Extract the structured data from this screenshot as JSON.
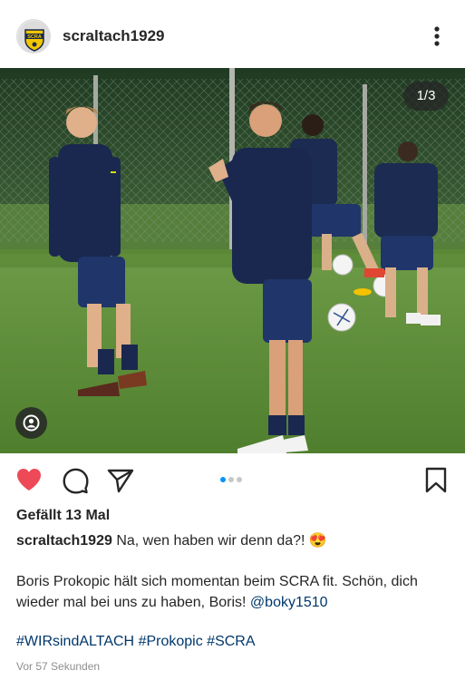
{
  "post": {
    "username": "scraltach1929",
    "avatar_label": "SCRA",
    "image_counter": "1/3",
    "likes": "Gefällt 13 Mal",
    "caption_user": "scraltach1929",
    "caption_text": "Na, wen haben wir denn da?!",
    "caption_emoji": "😍",
    "body_text": "Boris Prokopic hält sich momentan beim SCRA fit. Schön, dich wieder mal bei uns zu haben, Boris!",
    "mention": "@boky1510",
    "hashtags": [
      "#WIRsindALTACH",
      "#Prokopic",
      "#SCRA"
    ],
    "time": "Vor 57 Sekunden"
  },
  "carousel": {
    "count": 3,
    "active": 1
  },
  "icons": {
    "more": "more-vertical-icon",
    "like": "heart-filled-icon",
    "comment": "comment-icon",
    "share": "share-icon",
    "save": "bookmark-icon",
    "tag": "user-tag-icon"
  },
  "colors": {
    "like": "#ed4956",
    "link": "#00376b",
    "active_dot": "#0095f6",
    "muted": "#8e8e8e"
  }
}
